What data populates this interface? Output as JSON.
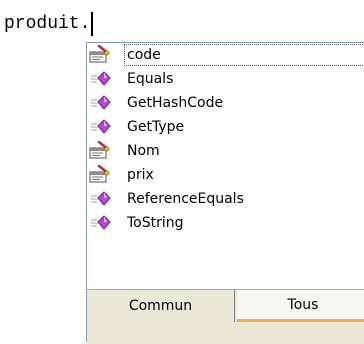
{
  "editor": {
    "text": "produit."
  },
  "intellisense": {
    "items": [
      {
        "label": "code",
        "kind": "property",
        "icon": "property-icon",
        "selected": true
      },
      {
        "label": "Equals",
        "kind": "method",
        "icon": "method-icon"
      },
      {
        "label": "GetHashCode",
        "kind": "method",
        "icon": "method-icon"
      },
      {
        "label": "GetType",
        "kind": "method",
        "icon": "method-icon"
      },
      {
        "label": "Nom",
        "kind": "property",
        "icon": "property-icon"
      },
      {
        "label": "prix",
        "kind": "property",
        "icon": "property-icon"
      },
      {
        "label": "ReferenceEquals",
        "kind": "method",
        "icon": "method-icon"
      },
      {
        "label": "ToString",
        "kind": "method",
        "icon": "method-icon"
      }
    ],
    "tabs": [
      {
        "label": "Commun",
        "active": true
      },
      {
        "label": "Tous",
        "active": false
      }
    ]
  },
  "colors": {
    "popup_border": "#7f9db9",
    "tab_strip": "#ece9d8",
    "tab_highlight": "#f0b24a",
    "method_icon": "#b34bd6",
    "property_icon": "#6b6b6b"
  }
}
